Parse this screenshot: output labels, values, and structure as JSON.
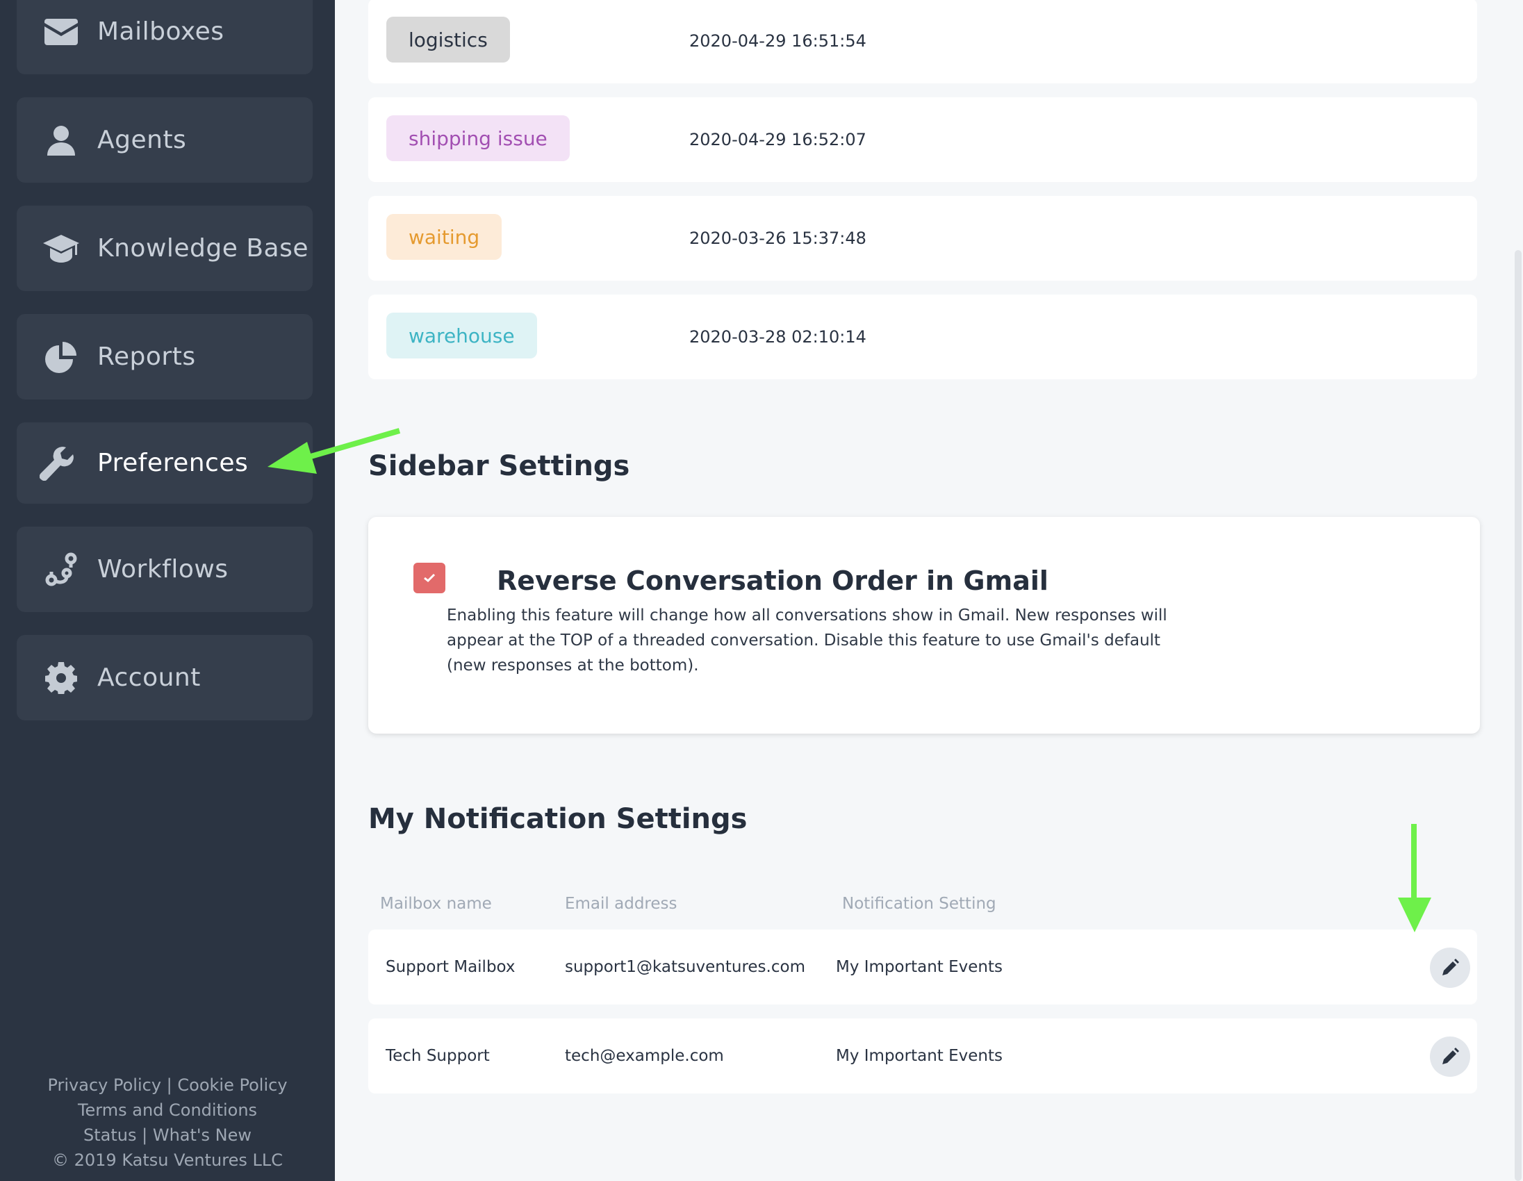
{
  "sidebar": {
    "items": [
      {
        "label": "Mailboxes",
        "icon": "envelope-icon"
      },
      {
        "label": "Agents",
        "icon": "user-icon"
      },
      {
        "label": "Knowledge Base",
        "icon": "graduation-cap-icon"
      },
      {
        "label": "Reports",
        "icon": "pie-chart-icon"
      },
      {
        "label": "Preferences",
        "icon": "wrench-icon"
      },
      {
        "label": "Workflows",
        "icon": "workflow-icon"
      },
      {
        "label": "Account",
        "icon": "gear-icon"
      }
    ],
    "active": "Preferences",
    "footer": {
      "privacy": "Privacy Policy",
      "sep1": "|",
      "cookie": "Cookie Policy",
      "terms": "Terms and Conditions",
      "status": "Status",
      "sep2": "|",
      "whats_new": "What's New",
      "copyright": "© 2019 Katsu Ventures LLC"
    }
  },
  "tags": [
    {
      "name": "logistics",
      "date": "2020-04-29 16:51:54",
      "bg": "#d9d9d9",
      "fg": "#2a3342"
    },
    {
      "name": "shipping issue",
      "date": "2020-04-29 16:52:07",
      "bg": "#f3e2f6",
      "fg": "#a24fb2"
    },
    {
      "name": "waiting",
      "date": "2020-03-26 15:37:48",
      "bg": "#fdebd8",
      "fg": "#e59a2f"
    },
    {
      "name": "warehouse",
      "date": "2020-03-28 02:10:14",
      "bg": "#dff3f5",
      "fg": "#3db4c4"
    }
  ],
  "sidebar_settings": {
    "title": "Sidebar Settings",
    "option_title": "Reverse Conversation Order in Gmail",
    "option_desc": "Enabling this feature will change how all conversations show in Gmail. New responses will appear at the TOP of a threaded conversation. Disable this feature to use Gmail's default (new responses at the bottom).",
    "checked": true,
    "checkbox_color": "#e26a6a"
  },
  "notifications": {
    "title": "My Notification Settings",
    "headers": {
      "mailbox": "Mailbox name",
      "email": "Email address",
      "setting": "Notification Setting"
    },
    "rows": [
      {
        "mailbox": "Support Mailbox",
        "email": "support1@katsuventures.com",
        "setting": "My Important Events"
      },
      {
        "mailbox": "Tech Support",
        "email": "tech@example.com",
        "setting": "My Important Events"
      }
    ]
  },
  "colors": {
    "sidebar_bg": "#2b3442",
    "nav_item_bg": "#353e4c",
    "annotation_arrow": "#6ef04a"
  }
}
